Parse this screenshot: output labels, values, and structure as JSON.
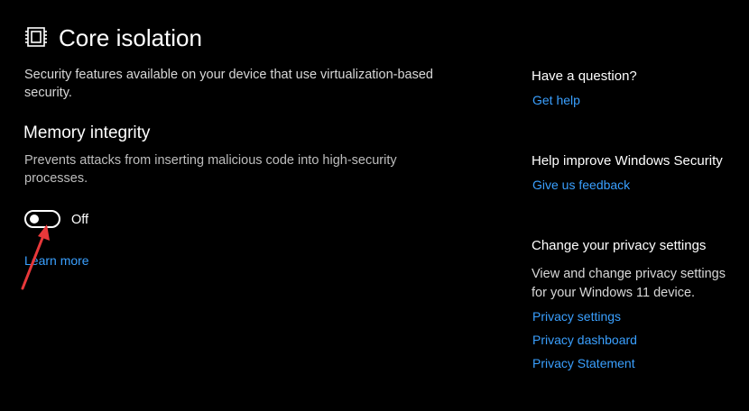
{
  "header": {
    "title": "Core isolation",
    "icon": "chip-icon",
    "description": "Security features available on your device that use virtualization-based security."
  },
  "memory_integrity": {
    "title": "Memory integrity",
    "description": "Prevents attacks from inserting malicious code into high-security processes.",
    "toggle_state_label": "Off",
    "toggle_on": false,
    "learn_more_label": "Learn more"
  },
  "sidebar": {
    "question": {
      "heading": "Have a question?",
      "link": "Get help"
    },
    "improve": {
      "heading": "Help improve Windows Security",
      "link": "Give us feedback"
    },
    "privacy": {
      "heading": "Change your privacy settings",
      "description": "View and change privacy settings for your Windows 11 device.",
      "links": [
        "Privacy settings",
        "Privacy dashboard",
        "Privacy Statement"
      ]
    }
  },
  "colors": {
    "background": "#000000",
    "link": "#3aa0ff",
    "annotation_arrow": "#e8383a"
  }
}
